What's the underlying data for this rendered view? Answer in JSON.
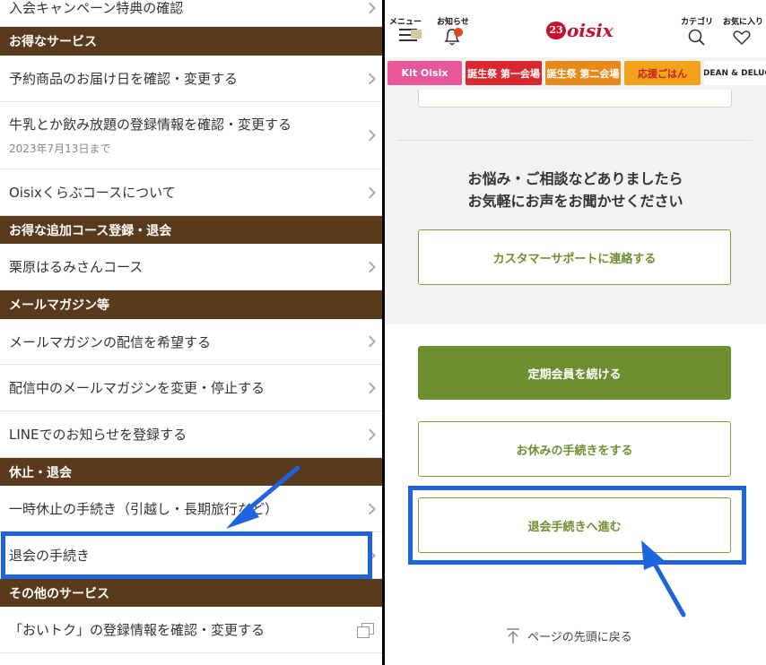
{
  "left": {
    "top_partial_row": "入会キャンペーン特典の確認",
    "sections": [
      {
        "title": "お得なサービス"
      },
      {
        "title": "お得な追加コース登録・退会"
      },
      {
        "title": "メールマガジン等"
      },
      {
        "title": "休止・退会"
      },
      {
        "title": "その他のサービス"
      }
    ],
    "rows": [
      {
        "label": "予約商品のお届け日を確認・変更する"
      },
      {
        "label": "牛乳とか飲み放題の登録情報を確認・変更する",
        "sub": "2023年7月13日まで"
      },
      {
        "label": "Oisixくらぶコースについて"
      },
      {
        "label": "栗原はるみさんコース"
      },
      {
        "label": "メールマガジンの配信を希望する"
      },
      {
        "label": "配信中のメールマガジンを変更・停止する"
      },
      {
        "label": "LINEでのお知らせを登録する"
      },
      {
        "label": "一時休止の手続き（引越し・長期旅行など）"
      },
      {
        "label": "退会の手続き"
      },
      {
        "label": "「おいトク」の登録情報を確認・変更する"
      }
    ]
  },
  "right": {
    "header": {
      "menu_label": "メニュー",
      "notice_label": "お知らせ",
      "logo_number": "23",
      "logo_text": "oisix",
      "category_label": "カテゴリ",
      "favorite_label": "お気に入り"
    },
    "banners": [
      {
        "text": "Kit Oisix",
        "bg": "#e8579a",
        "color": "#ffffff"
      },
      {
        "text": "誕生祭 第一会場",
        "bg": "#d9282f",
        "color": "#ffffff"
      },
      {
        "text": "誕生祭 第二会場",
        "bg": "#e88a1a",
        "color": "#ffffff"
      },
      {
        "text": "応援ごはん",
        "bg": "#f2a31c",
        "color": "#c81d25"
      },
      {
        "text": "DEAN & DELUCA",
        "bg": "#ffffff",
        "color": "#222222"
      }
    ],
    "message_line1": "お悩み・ご相談などありましたら",
    "message_line2": "お気軽にお声をお聞かせください",
    "support_button": "カスタマーサポートに連絡する",
    "continue_button": "定期会員を続ける",
    "pause_button": "お休みの手続きをする",
    "withdraw_button": "退会手続きへ進む",
    "page_top_link": "ページの先頭に戻る"
  },
  "colors": {
    "section_brown": "#5a3a1c",
    "oisix_green": "#6d8f2f",
    "oisix_red": "#c8102e",
    "highlight_blue": "#1e63e0"
  }
}
